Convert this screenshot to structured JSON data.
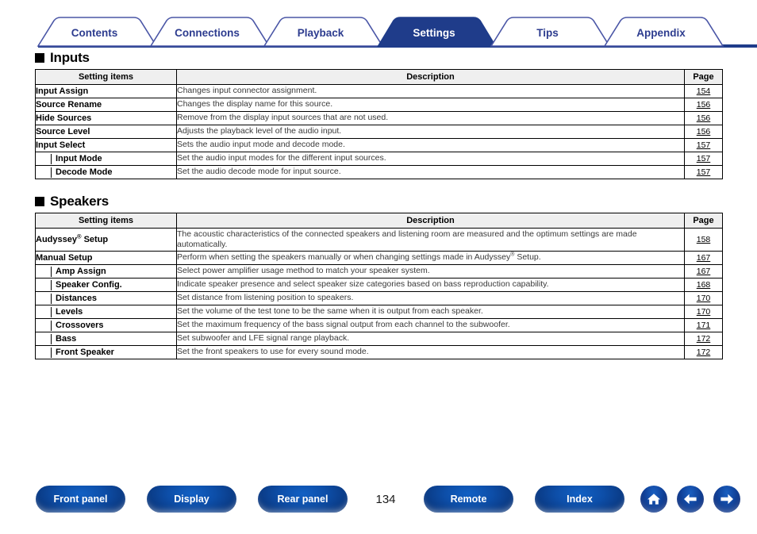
{
  "tabs": [
    {
      "label": "Contents",
      "active": false
    },
    {
      "label": "Connections",
      "active": false
    },
    {
      "label": "Playback",
      "active": false
    },
    {
      "label": "Settings",
      "active": true
    },
    {
      "label": "Tips",
      "active": false
    },
    {
      "label": "Appendix",
      "active": false
    }
  ],
  "columns": {
    "item": "Setting items",
    "description": "Description",
    "page": "Page"
  },
  "sections": [
    {
      "heading": "Inputs",
      "rows": [
        {
          "item": "Input Assign",
          "sub": false,
          "description": "Changes input connector assignment.",
          "page": "154"
        },
        {
          "item": "Source Rename",
          "sub": false,
          "description": "Changes the display name for this source.",
          "page": "156"
        },
        {
          "item": "Hide Sources",
          "sub": false,
          "description": "Remove from the display input sources that are not used.",
          "page": "156"
        },
        {
          "item": "Source Level",
          "sub": false,
          "description": "Adjusts the playback level of the audio input.",
          "page": "156"
        },
        {
          "item": "Input Select",
          "sub": false,
          "description": "Sets the audio input mode and decode mode.",
          "page": "157"
        },
        {
          "item": "Input Mode",
          "sub": true,
          "description": "Set the audio input modes for the different input sources.",
          "page": "157"
        },
        {
          "item": "Decode Mode",
          "sub": true,
          "description": "Set the audio decode mode for input source.",
          "page": "157"
        }
      ]
    },
    {
      "heading": "Speakers",
      "rows": [
        {
          "item": "Audyssey® Setup",
          "sub": false,
          "tall": true,
          "description": "The acoustic characteristics of the connected speakers and listening room are measured and the optimum settings are made automatically.",
          "page": "158"
        },
        {
          "item": "Manual Setup",
          "sub": false,
          "description": "Perform when setting the speakers manually or when changing settings made in Audyssey® Setup.",
          "page": "167"
        },
        {
          "item": "Amp Assign",
          "sub": true,
          "description": "Select power amplifier usage method to match your speaker system.",
          "page": "167"
        },
        {
          "item": "Speaker Config.",
          "sub": true,
          "description": "Indicate speaker presence and select speaker size categories based on bass reproduction capability.",
          "page": "168"
        },
        {
          "item": "Distances",
          "sub": true,
          "description": "Set distance from listening position to speakers.",
          "page": "170"
        },
        {
          "item": "Levels",
          "sub": true,
          "description": "Set the volume of the test tone to be the same when it is output from each speaker.",
          "page": "170"
        },
        {
          "item": "Crossovers",
          "sub": true,
          "description": "Set the maximum frequency of the bass signal output from each channel to the subwoofer.",
          "page": "171"
        },
        {
          "item": "Bass",
          "sub": true,
          "description": "Set subwoofer and LFE signal range playback.",
          "page": "172"
        },
        {
          "item": "Front Speaker",
          "sub": true,
          "description": "Set the front speakers to use for every sound mode.",
          "page": "172"
        }
      ]
    }
  ],
  "footer": {
    "buttons": [
      {
        "label": "Front panel"
      },
      {
        "label": "Display"
      },
      {
        "label": "Rear panel"
      }
    ],
    "page_number": "134",
    "buttons_right": [
      {
        "label": "Remote"
      },
      {
        "label": "Index"
      }
    ],
    "icons": [
      {
        "name": "home-icon"
      },
      {
        "name": "arrow-left-icon"
      },
      {
        "name": "arrow-right-icon"
      }
    ]
  },
  "colors": {
    "tab_navy": "#1f3c8a",
    "tab_outline": "#3a4b9e",
    "tab_text": "#2d3c8f",
    "header_bg": "#efefef",
    "button_blue": "#0d4ea8"
  }
}
